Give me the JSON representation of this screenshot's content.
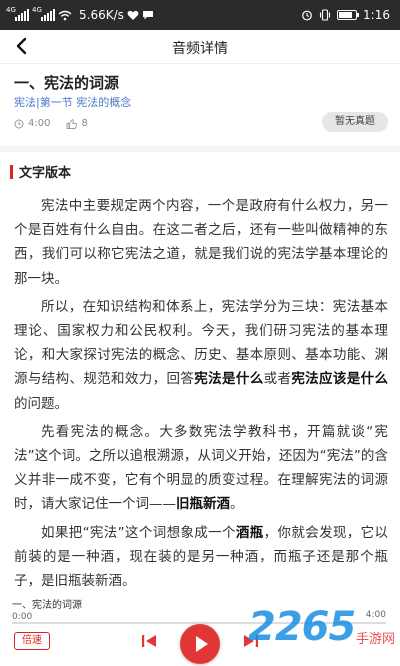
{
  "status_bar": {
    "signal1_label": "4G",
    "signal2_label": "4G",
    "speed": "5.66K/s",
    "battery_level": 0.8,
    "time": "1:16"
  },
  "nav": {
    "back_icon": "chevron-left-icon",
    "title": "音频详情"
  },
  "lesson": {
    "title": "一、宪法的词源",
    "subtitle": "宪法|第一节 宪法的概念",
    "duration": "4:00",
    "likes": "8",
    "no_question_label": "暂无真题"
  },
  "section": {
    "label": "文字版本",
    "accent": "#dd2222"
  },
  "article": {
    "p1": "宪法中主要规定两个内容，一个是政府有什么权力，另一个是百姓有什么自由。在这二者之后，还有一些叫做精神的东西，我们可以称它宪法之道，就是我们说的宪法学基本理论的那一块。",
    "p2_a": "所以，在知识结构和体系上，宪法学分为三块：宪法基本理论、国家权力和公民权利。今天，我们研习宪法的基本理论，和大家探讨宪法的概念、历史、基本原则、基本功能、渊源与结构、规范和效力，回答",
    "p2_b1": "宪法是什么",
    "p2_c": "或者",
    "p2_b2": "宪法应该是什么",
    "p2_d": "的问题。",
    "p3_a": "先看宪法的概念。大多数宪法学教科书，开篇就谈“宪法”这个词。之所以追根溯源，从词义开始，还因为“宪法”的含义并非一成不变，它有个明显的质变过程。在理解宪法的词源时，请大家记住一个词——",
    "p3_b": "旧瓶新酒",
    "p3_c": "。",
    "p4_a": "如果把“宪法”这个词想象成一个",
    "p4_b": "酒瓶",
    "p4_c": "，你就会发现，它以前装的是一种酒，现在装的是另一种酒，而瓶子还是那个瓶子，是旧瓶装新酒。"
  },
  "player": {
    "now_title": "一、宪法的词源",
    "time_start": "0:00",
    "time_end": "4:00",
    "progress": 0,
    "speed_label": "倍速",
    "prev_icon": "skip-previous-icon",
    "play_icon": "play-icon",
    "next_icon": "skip-next-icon",
    "accent": "#e23535"
  },
  "watermark": {
    "number": "2265",
    "site": "手游网"
  }
}
